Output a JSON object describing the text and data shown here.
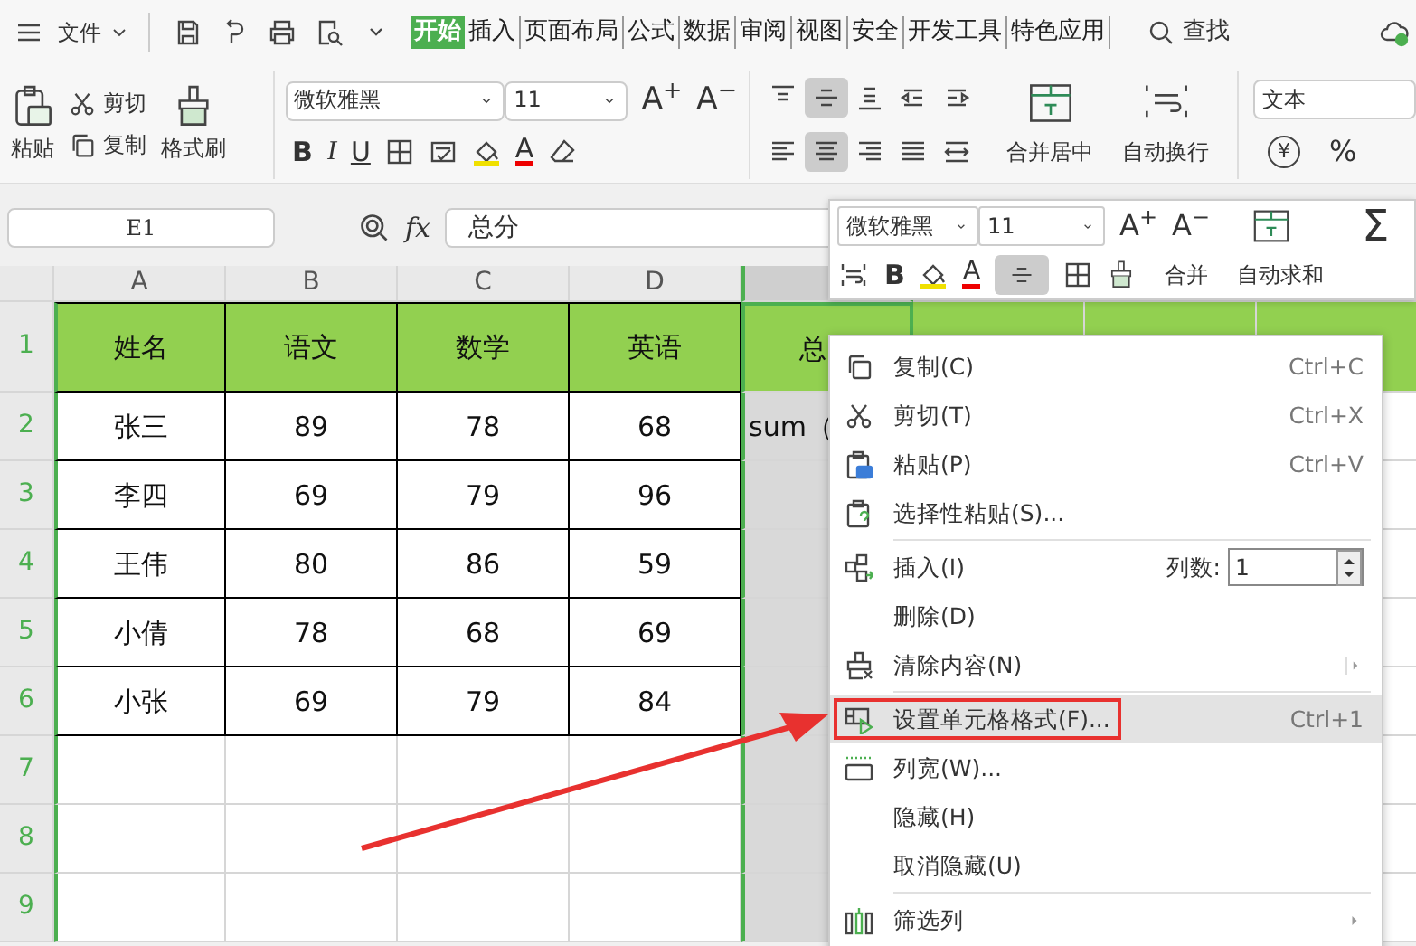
{
  "menu_bar": {
    "file_menu": "文件",
    "tabs": [
      {
        "label": "开始",
        "selected": true
      },
      {
        "label": "插入",
        "selected": false
      },
      {
        "label": "页面布局",
        "selected": false
      },
      {
        "label": "公式",
        "selected": false
      },
      {
        "label": "数据",
        "selected": false
      },
      {
        "label": "审阅",
        "selected": false
      },
      {
        "label": "视图",
        "selected": false
      },
      {
        "label": "安全",
        "selected": false
      },
      {
        "label": "开发工具",
        "selected": false
      },
      {
        "label": "特色应用",
        "selected": false
      }
    ],
    "search": "查找"
  },
  "ribbon": {
    "clipboard": {
      "paste": "粘贴",
      "cut": "剪切",
      "copy": "复制",
      "format_painter": "格式刷"
    },
    "font": {
      "name": "微软雅黑",
      "size": "11",
      "grow": "A$^{+}$",
      "shrink": "A$^{−}$",
      "bold": "B",
      "italic": "I",
      "underline": "U",
      "font_color": "A"
    },
    "alignment": {
      "top_row": [
        {
          "selected": false
        },
        {
          "selected": true
        },
        {
          "selected": false
        },
        {
          "selected": false
        },
        {
          "selected": false
        }
      ],
      "bottom_row": [
        {
          "selected": false
        },
        {
          "selected": true
        },
        {
          "selected": false
        },
        {
          "selected": false
        },
        {
          "selected": false
        }
      ],
      "merge": "合并居中",
      "wrap": "自动换行"
    },
    "number": {
      "format": "文本",
      "currency": "¥",
      "percent": "%"
    }
  },
  "formula_bar": {
    "cell": "E1",
    "fx": "fx",
    "value": "总分"
  },
  "columns": [
    {
      "label": "A",
      "selected": false
    },
    {
      "label": "B",
      "selected": false
    },
    {
      "label": "C",
      "selected": false
    },
    {
      "label": "D",
      "selected": false
    },
    {
      "selected": true
    }
  ],
  "row_numbers": [
    "1",
    "2",
    "3",
    "4",
    "5",
    "6",
    "7",
    "8",
    "9"
  ],
  "rows": [
    {
      "kind": "header",
      "cells": [
        "姓名",
        "语文",
        "数学",
        "英语",
        "总"
      ]
    },
    {
      "kind": "data",
      "cells": [
        "张三",
        "89",
        "78",
        "68",
        "sum（"
      ]
    },
    {
      "kind": "data",
      "cells": [
        "李四",
        "69",
        "79",
        "96"
      ]
    },
    {
      "kind": "data",
      "cells": [
        "王伟",
        "80",
        "86",
        "59"
      ]
    },
    {
      "kind": "data",
      "cells": [
        "小倩",
        "78",
        "68",
        "69"
      ]
    },
    {
      "kind": "data",
      "cells": [
        "小张",
        "69",
        "79",
        "84"
      ]
    }
  ],
  "mini_toolbar": {
    "font": "微软雅黑",
    "size": "11",
    "grow": "A$^{+}$",
    "shrink": "A$^{−}$",
    "bold": "B",
    "font_color": "A",
    "align_pressed": true,
    "merge": "合并",
    "autosum_symbol": "Σ",
    "autosum": "自动求和"
  },
  "context_menu": [
    {
      "kind": "item",
      "label": "复制(C)",
      "shortcut": "Ctrl+C"
    },
    {
      "kind": "item",
      "label": "剪切(T)",
      "shortcut": "Ctrl+X"
    },
    {
      "kind": "item",
      "label": "粘贴(P)",
      "shortcut": "Ctrl+V"
    },
    {
      "kind": "item",
      "label": "选择性粘贴(S)..."
    },
    {
      "kind": "separator"
    },
    {
      "kind": "spin",
      "label": "插入(I)",
      "count_label": "列数:",
      "count_value": "1"
    },
    {
      "kind": "item",
      "label": "删除(D)"
    },
    {
      "kind": "item",
      "label": "清除内容(N)",
      "submenu": true
    },
    {
      "kind": "separator"
    },
    {
      "kind": "item",
      "label": "设置单元格格式(F)...",
      "shortcut": "Ctrl+1",
      "selected": true,
      "annotated": true
    },
    {
      "kind": "item",
      "label": "列宽(W)..."
    },
    {
      "kind": "item",
      "label": "隐藏(H)"
    },
    {
      "kind": "item",
      "label": "取消隐藏(U)"
    },
    {
      "kind": "separator"
    },
    {
      "kind": "item",
      "label": "筛选列",
      "submenu": true
    }
  ]
}
